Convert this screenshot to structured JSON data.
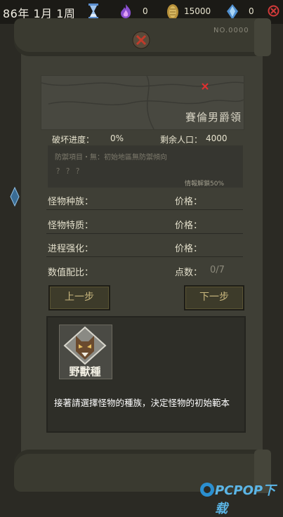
{
  "topbar": {
    "date": "86年 1月 1周",
    "fire_value": "0",
    "coin_value": "15000",
    "crystal_value": "0",
    "icons": {
      "hourglass": "hourglass-icon",
      "fire": "fire-icon",
      "coin": "coin-icon",
      "crystal": "crystal-icon",
      "close": "close-icon"
    }
  },
  "scroll": {
    "doc_number": "NO.0000"
  },
  "region": {
    "name": "賽倫男爵領"
  },
  "stats": {
    "destruction_label": "破坏进度：",
    "destruction_value": "0%",
    "population_label": "剩余人口：",
    "population_value": "4000"
  },
  "info": {
    "defense_text": "防禦項目・無：初始地區無防禦傾向",
    "hidden_text": "？？？",
    "unlock_text": "情報解鎖50%"
  },
  "attributes": [
    {
      "label": "怪物种族：",
      "right_label": "价格："
    },
    {
      "label": "怪物特质：",
      "right_label": "价格："
    },
    {
      "label": "进程强化：",
      "right_label": "价格："
    },
    {
      "label": "数值配比：",
      "right_label": "点数：",
      "right_value": "0/7"
    }
  ],
  "buttons": {
    "prev": "上一步",
    "next": "下一步"
  },
  "selection": {
    "card_label": "野獸種",
    "instruction": "接著請選擇怪物的種族，決定怪物的初始範本"
  },
  "watermark": "PCPOP下载",
  "colors": {
    "accent": "#c9b77e",
    "panel": "#3f3f36",
    "fire": "#9b5bd6",
    "coin": "#c9a24a",
    "crystal": "#5c9fd6",
    "close": "#d23a3a"
  }
}
